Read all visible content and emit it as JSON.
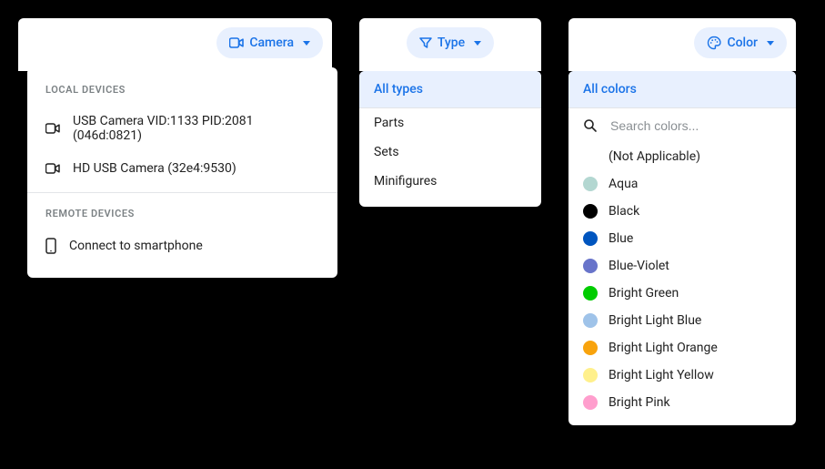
{
  "camera": {
    "chip_label": "Camera",
    "local_header": "LOCAL DEVICES",
    "remote_header": "REMOTE DEVICES",
    "local_devices": [
      "USB Camera VID:1133 PID:2081 (046d:0821)",
      "HD USB Camera (32e4:9530)"
    ],
    "remote_action": "Connect to smartphone"
  },
  "type": {
    "chip_label": "Type",
    "selected": "All types",
    "options": [
      "Parts",
      "Sets",
      "Minifigures"
    ]
  },
  "color": {
    "chip_label": "Color",
    "selected": "All colors",
    "search_placeholder": "Search colors...",
    "items": [
      {
        "name": "(Not Applicable)",
        "hex": ""
      },
      {
        "name": "Aqua",
        "hex": "#b3d7d1"
      },
      {
        "name": "Black",
        "hex": "#000000"
      },
      {
        "name": "Blue",
        "hex": "#0055bf"
      },
      {
        "name": "Blue-Violet",
        "hex": "#6874ca"
      },
      {
        "name": "Bright Green",
        "hex": "#00cc00"
      },
      {
        "name": "Bright Light Blue",
        "hex": "#9fc3e9"
      },
      {
        "name": "Bright Light Orange",
        "hex": "#f8a30d"
      },
      {
        "name": "Bright Light Yellow",
        "hex": "#fff08c"
      },
      {
        "name": "Bright Pink",
        "hex": "#ff9ecd"
      }
    ]
  }
}
